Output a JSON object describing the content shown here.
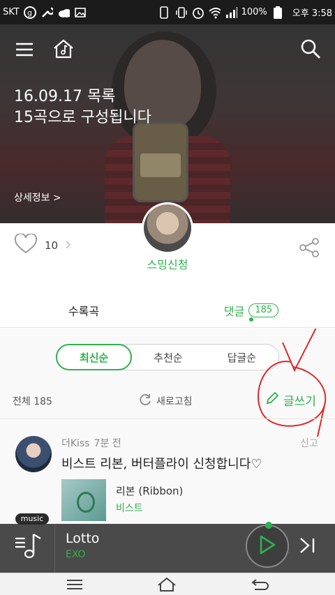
{
  "status_bar": {
    "carrier": "SKT",
    "battery": "100%",
    "time": "오후 3:58"
  },
  "hero": {
    "title_line1": "16.09.17 목록",
    "title_line2": "15곡으로 구성됩니다",
    "detail_link": "상세정보 >"
  },
  "profile": {
    "like_count": "10",
    "owner_name": "스밍신청"
  },
  "tabs": {
    "tracks_label": "수록곡",
    "comments_label": "댓글",
    "comments_count": "185"
  },
  "sort": {
    "options": [
      "최신순",
      "추천순",
      "답글순"
    ],
    "selected": "최신순"
  },
  "comments_toolbar": {
    "total_label": "전체 185",
    "refresh_label": "새로고침",
    "write_label": "글쓰기"
  },
  "comment": {
    "author": "더Kiss",
    "time": "7분 전",
    "report_label": "신고",
    "text": "비스트 리본, 버터플라이 신청합니다♡",
    "song_title": "리본 (Ribbon)",
    "song_artist": "비스트"
  },
  "player": {
    "tag": "music",
    "title": "Lotto",
    "artist": "EXO"
  },
  "colors": {
    "accent": "#2eb24e",
    "annotation_red": "#e0282a"
  }
}
